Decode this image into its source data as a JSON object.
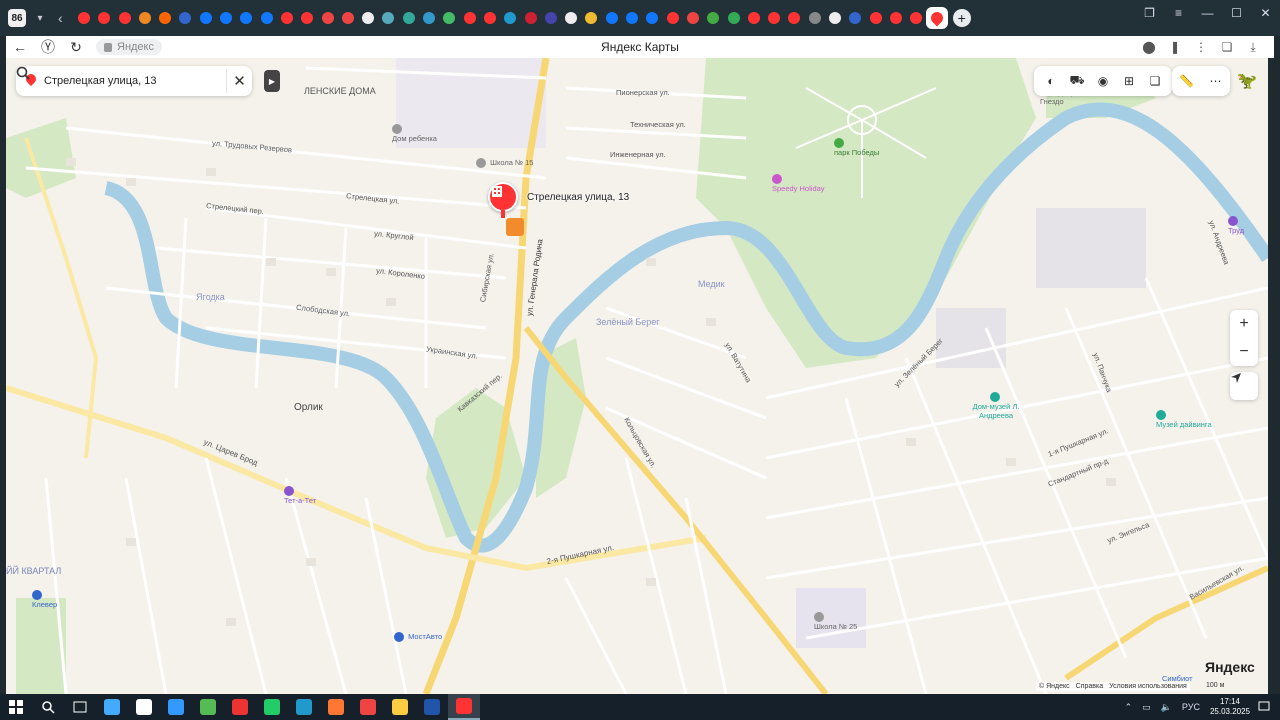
{
  "browser": {
    "tab_count": "86",
    "tab_icon_colors": [
      "#f33",
      "#f33",
      "#f33",
      "#e82",
      "#f60",
      "#36c",
      "#17f",
      "#17f",
      "#17f",
      "#17f",
      "#f33",
      "#f33",
      "#e44",
      "#e44",
      "#eee",
      "#5ab",
      "#3a9",
      "#39c",
      "#4b6",
      "#f33",
      "#f33",
      "#29c",
      "#c23",
      "#44a",
      "#eee",
      "#eb3",
      "#17f",
      "#17f",
      "#17f",
      "#f33",
      "#e44",
      "#4a4",
      "#3a5",
      "#f33",
      "#f33",
      "#f33",
      "#888",
      "#eee",
      "#36c",
      "#f33",
      "#f33",
      "#f33"
    ],
    "active_tab_color": "#f33",
    "address": "Яндекс",
    "page_title": "Яндекс Карты"
  },
  "search": {
    "value": "Стрелецкая улица, 13"
  },
  "map": {
    "selected_label": "Стрелецкая улица, 13",
    "logo": "Яндекс",
    "footer": [
      "© Яндекс",
      "Справка",
      "Условия использования"
    ],
    "scale": "100 м",
    "districts": [
      {
        "label": "ЛЕНСКИЕ ДОМА",
        "color": "#7a86b8"
      },
      {
        "label": "Ягодка",
        "color": "#8a93c4"
      },
      {
        "label": "Орлик",
        "color": "#555"
      },
      {
        "label": "Медик",
        "color": "#8a93c4"
      },
      {
        "label": "Зелёный Берег",
        "color": "#8a93c4"
      },
      {
        "label": "ЙЙ КВАРТАЛ",
        "color": "#7a86b8"
      }
    ],
    "streets": [
      "ул. Трудовых Резервов",
      "Стрелецкая ул.",
      "Стрелецкий пер.",
      "ул. Круглой",
      "ул. Короленко",
      "Слободская ул.",
      "Украинская ул.",
      "Сибирская ул.",
      "ул. Генерала Родина",
      "Кавказский пер.",
      "ул. Царев Брод",
      "2-я Пушкарная ул.",
      "Кольцовская ул.",
      "ул. Зелёный Берег",
      "1-я Пушкарная ул.",
      "Васильевская ул.",
      "ул. Энгельса",
      "Инженерная ул.",
      "Техническая ул.",
      "Пионерская ул.",
      "ул. Ватутина",
      "ул. Андреева",
      "Стандартный пр-д",
      "ул. Панчука"
    ],
    "pois": [
      {
        "label": "Дом ребенка",
        "color": "#888"
      },
      {
        "label": "Школа № 15",
        "color": "#888"
      },
      {
        "label": "парк Победы",
        "color": "#4a4"
      },
      {
        "label": "Speedy Holiday",
        "color": "#c5c"
      },
      {
        "label": "парк Дворянское Гнездо",
        "color": "#666"
      },
      {
        "label": "Дом-музей Л. Андреева",
        "color": "#2a9"
      },
      {
        "label": "Музей дайвинга",
        "color": "#2a9"
      },
      {
        "label": "Тет-а-Тет",
        "color": "#85c"
      },
      {
        "label": "МостАвто",
        "color": "#36c"
      },
      {
        "label": "Школа № 25",
        "color": "#888"
      },
      {
        "label": "Клевер",
        "color": "#36c"
      },
      {
        "label": "Труд",
        "color": "#85c"
      },
      {
        "label": "Симбиот",
        "color": "#36c"
      }
    ]
  },
  "taskbar": {
    "apps": [
      "#4af",
      "#fff",
      "#39f",
      "#5b5",
      "#e33",
      "#2c6",
      "#29c",
      "#f73",
      "#e44",
      "#fc4",
      "#25a",
      "#f33"
    ],
    "lang": "РУС",
    "time": "17:14",
    "date": "25.03.2025"
  }
}
